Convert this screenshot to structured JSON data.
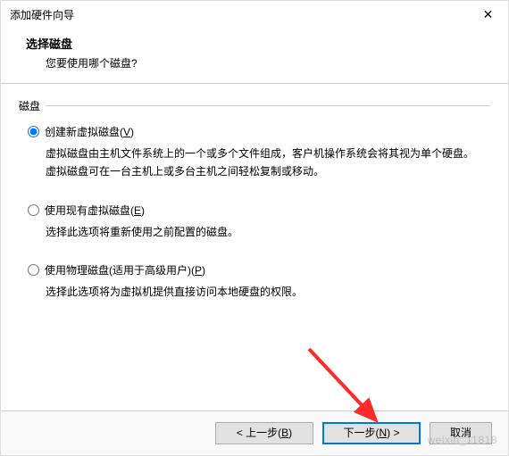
{
  "window": {
    "title": "添加硬件向导",
    "close_glyph": "✕"
  },
  "header": {
    "heading": "选择磁盘",
    "subheading": "您要使用哪个磁盘?"
  },
  "fieldset": {
    "legend": "磁盘"
  },
  "options": [
    {
      "id": "create-new",
      "label_pre": "创建新虚拟磁盘(",
      "hotkey": "V",
      "label_post": ")",
      "checked": true,
      "desc": "虚拟磁盘由主机文件系统上的一个或多个文件组成，客户机操作系统会将其视为单个硬盘。虚拟磁盘可在一台主机上或多台主机之间轻松复制或移动。"
    },
    {
      "id": "use-existing",
      "label_pre": "使用现有虚拟磁盘(",
      "hotkey": "E",
      "label_post": ")",
      "checked": false,
      "desc": "选择此选项将重新使用之前配置的磁盘。"
    },
    {
      "id": "use-physical",
      "label_pre": "使用物理磁盘(适用于高级用户)(",
      "hotkey": "P",
      "label_post": ")",
      "checked": false,
      "desc": "选择此选项将为虚拟机提供直接访问本地硬盘的权限。"
    }
  ],
  "buttons": {
    "back_pre": "< 上一步(",
    "back_hotkey": "B",
    "back_post": ")",
    "next_pre": "下一步(",
    "next_hotkey": "N",
    "next_post": ") >",
    "cancel": "取消"
  },
  "annotation": {
    "arrow_color": "#ff2a2a"
  },
  "watermark": "weixin_11818"
}
